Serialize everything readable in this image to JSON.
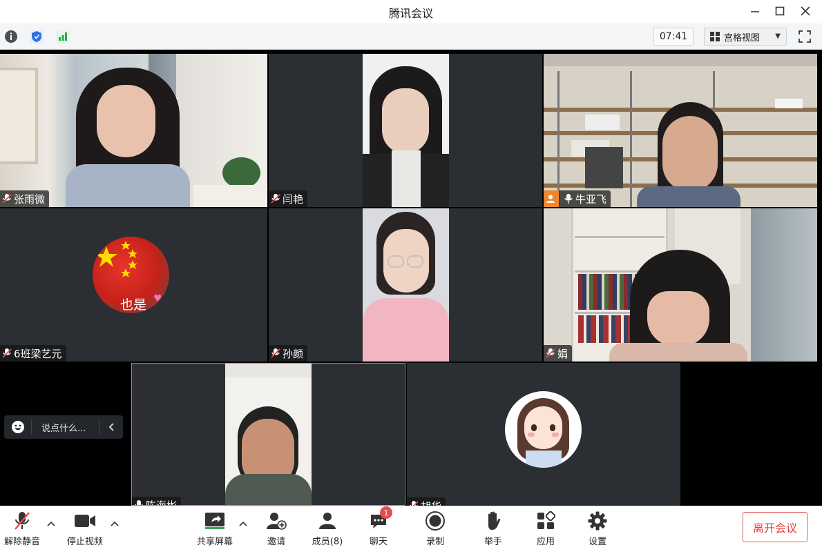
{
  "window": {
    "title": "腾讯会议"
  },
  "infobar": {
    "timer": "07:41",
    "view_mode": "宫格视图"
  },
  "participants": [
    {
      "name": "张雨微",
      "mic": "muted"
    },
    {
      "name": "闫艳",
      "mic": "muted"
    },
    {
      "name": "牛亚飞",
      "mic": "on",
      "role": "host"
    },
    {
      "name": "6班梁艺元",
      "mic": "muted",
      "avatar_text": "也是"
    },
    {
      "name": "孙颜",
      "mic": "muted"
    },
    {
      "name": "娟",
      "mic": "muted"
    },
    {
      "name": "陈海彬",
      "mic": "on",
      "speaking": true
    },
    {
      "name": "胡华",
      "mic": "muted"
    }
  ],
  "chat": {
    "placeholder": "说点什么..."
  },
  "toolbar": {
    "unmute": "解除静音",
    "stop_video": "停止视频",
    "share_screen": "共享屏幕",
    "invite": "邀请",
    "members": "成员(8)",
    "chat": "聊天",
    "chat_badge": "1",
    "record": "录制",
    "raise_hand": "举手",
    "apps": "应用",
    "settings": "设置",
    "leave": "离开会议"
  },
  "colors": {
    "accent_green": "#3ec06b",
    "host_orange": "#f0862b",
    "leave_red": "#e04040",
    "tile_bg": "#2b2f33"
  }
}
